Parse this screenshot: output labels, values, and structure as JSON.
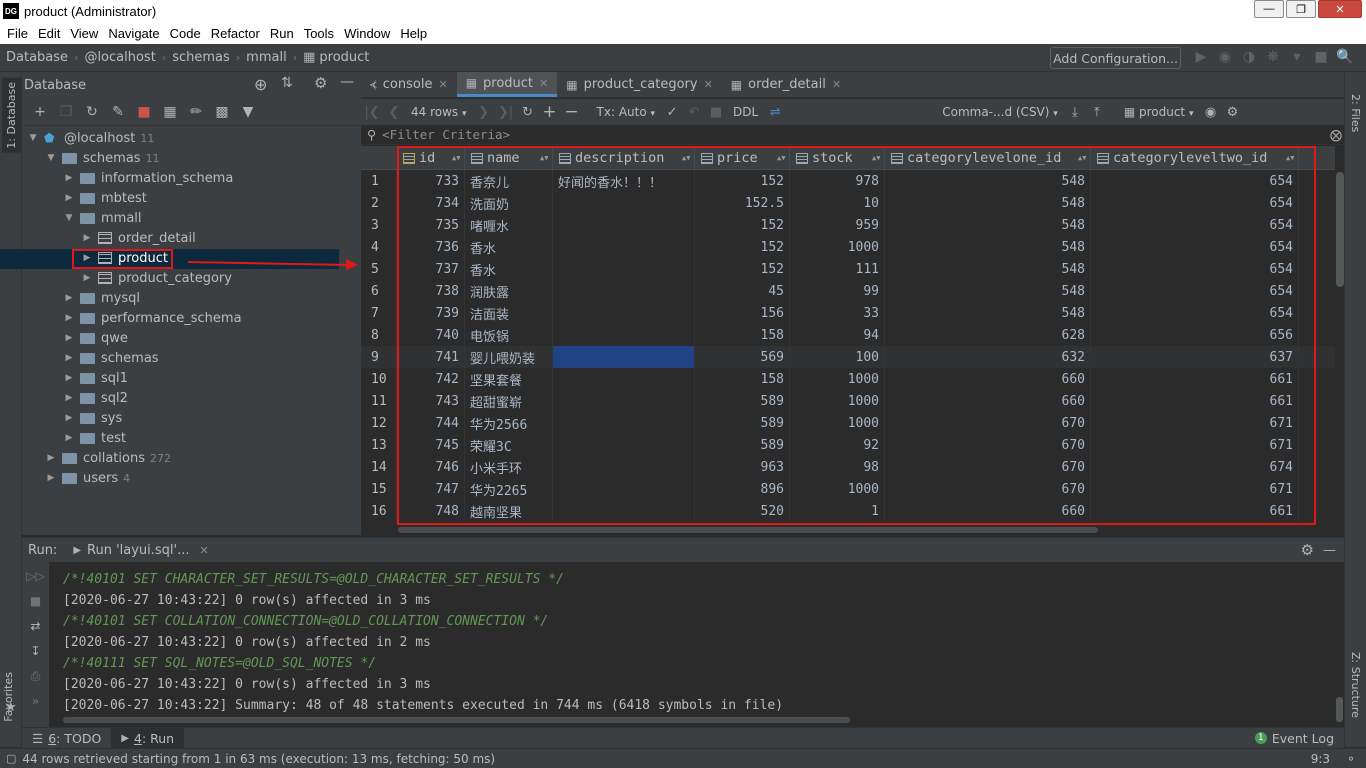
{
  "window": {
    "title": "product (Administrator)",
    "logo": "DG",
    "controls": [
      "minimize-icon",
      "maximize-icon",
      "close-icon"
    ]
  },
  "menu": [
    "File",
    "Edit",
    "View",
    "Navigate",
    "Code",
    "Refactor",
    "Run",
    "Tools",
    "Window",
    "Help"
  ],
  "breadcrumb": [
    "Database",
    "@localhost",
    "schemas",
    "mmall",
    "product"
  ],
  "add_configuration": "Add Configuration...",
  "db_panel": {
    "title": "Database",
    "tree": [
      {
        "label": "@localhost",
        "count": "11",
        "depth": 0,
        "expanded": true,
        "kind": "host"
      },
      {
        "label": "schemas",
        "count": "11",
        "depth": 1,
        "expanded": true,
        "kind": "folder"
      },
      {
        "label": "information_schema",
        "count": "",
        "depth": 2,
        "expanded": false,
        "kind": "folder"
      },
      {
        "label": "mbtest",
        "count": "",
        "depth": 2,
        "expanded": false,
        "kind": "folder"
      },
      {
        "label": "mmall",
        "count": "",
        "depth": 2,
        "expanded": true,
        "kind": "folder"
      },
      {
        "label": "order_detail",
        "count": "",
        "depth": 3,
        "expanded": false,
        "kind": "table"
      },
      {
        "label": "product",
        "count": "",
        "depth": 3,
        "expanded": false,
        "kind": "table",
        "selected": true
      },
      {
        "label": "product_category",
        "count": "",
        "depth": 3,
        "expanded": false,
        "kind": "table"
      },
      {
        "label": "mysql",
        "count": "",
        "depth": 2,
        "expanded": false,
        "kind": "folder"
      },
      {
        "label": "performance_schema",
        "count": "",
        "depth": 2,
        "expanded": false,
        "kind": "folder"
      },
      {
        "label": "qwe",
        "count": "",
        "depth": 2,
        "expanded": false,
        "kind": "folder"
      },
      {
        "label": "schemas",
        "count": "",
        "depth": 2,
        "expanded": false,
        "kind": "folder"
      },
      {
        "label": "sql1",
        "count": "",
        "depth": 2,
        "expanded": false,
        "kind": "folder"
      },
      {
        "label": "sql2",
        "count": "",
        "depth": 2,
        "expanded": false,
        "kind": "folder"
      },
      {
        "label": "sys",
        "count": "",
        "depth": 2,
        "expanded": false,
        "kind": "folder"
      },
      {
        "label": "test",
        "count": "",
        "depth": 2,
        "expanded": false,
        "kind": "folder"
      },
      {
        "label": "collations",
        "count": "272",
        "depth": 1,
        "expanded": false,
        "kind": "folder"
      },
      {
        "label": "users",
        "count": "4",
        "depth": 1,
        "expanded": false,
        "kind": "folder"
      }
    ]
  },
  "editor_tabs": [
    {
      "label": "console",
      "icon": "console-icon",
      "active": false
    },
    {
      "label": "product",
      "icon": "table-icon",
      "active": true
    },
    {
      "label": "product_category",
      "icon": "table-icon",
      "active": false
    },
    {
      "label": "order_detail",
      "icon": "table-icon",
      "active": false
    }
  ],
  "grid_toolbar": {
    "rows": "44 rows",
    "tx": "Tx: Auto",
    "ddl": "DDL",
    "format": "Comma-...d (CSV)",
    "target": "product"
  },
  "filter_placeholder": "<Filter Criteria>",
  "grid": {
    "columns": [
      "id",
      "name",
      "description",
      "price",
      "stock",
      "categorylevelone_id",
      "categoryleveltwo_id"
    ],
    "rows": [
      [
        "1",
        "733",
        "香奈儿",
        "好闻的香水！！！",
        "152",
        "978",
        "548",
        "654"
      ],
      [
        "2",
        "734",
        "洗面奶",
        "",
        "152.5",
        "10",
        "548",
        "654"
      ],
      [
        "3",
        "735",
        "啫喱水",
        "",
        "152",
        "959",
        "548",
        "654"
      ],
      [
        "4",
        "736",
        "香水",
        "",
        "152",
        "1000",
        "548",
        "654"
      ],
      [
        "5",
        "737",
        "香水",
        "",
        "152",
        "111",
        "548",
        "654"
      ],
      [
        "6",
        "738",
        "润肤露",
        "",
        "45",
        "99",
        "548",
        "654"
      ],
      [
        "7",
        "739",
        "洁面装",
        "",
        "156",
        "33",
        "548",
        "654"
      ],
      [
        "8",
        "740",
        "电饭锅",
        "",
        "158",
        "94",
        "628",
        "656"
      ],
      [
        "9",
        "741",
        "婴儿喂奶装",
        "",
        "569",
        "100",
        "632",
        "637"
      ],
      [
        "10",
        "742",
        "坚果套餐",
        "",
        "158",
        "1000",
        "660",
        "661"
      ],
      [
        "11",
        "743",
        "超甜蜜崭",
        "",
        "589",
        "1000",
        "660",
        "661"
      ],
      [
        "12",
        "744",
        "华为2566",
        "",
        "589",
        "1000",
        "670",
        "671"
      ],
      [
        "13",
        "745",
        "荣耀3C",
        "",
        "589",
        "92",
        "670",
        "671"
      ],
      [
        "14",
        "746",
        "小米手环",
        "",
        "963",
        "98",
        "670",
        "674"
      ],
      [
        "15",
        "747",
        "华为2265",
        "",
        "896",
        "1000",
        "670",
        "671"
      ],
      [
        "16",
        "748",
        "越南坚果",
        "",
        "520",
        "1",
        "660",
        "661"
      ]
    ]
  },
  "run_panel": {
    "label": "Run:",
    "tab": "Run 'layui.sql'...",
    "lines": [
      {
        "text": "/*!40101 SET CHARACTER_SET_RESULTS=@OLD_CHARACTER_SET_RESULTS */",
        "comment": true
      },
      {
        "text": "[2020-06-27 10:43:22] 0 row(s) affected in 3 ms",
        "comment": false
      },
      {
        "text": "/*!40101 SET COLLATION_CONNECTION=@OLD_COLLATION_CONNECTION */",
        "comment": true
      },
      {
        "text": "[2020-06-27 10:43:22] 0 row(s) affected in 2 ms",
        "comment": false
      },
      {
        "text": "/*!40111 SET SQL_NOTES=@OLD_SQL_NOTES */",
        "comment": true
      },
      {
        "text": "[2020-06-27 10:43:22] 0 row(s) affected in 3 ms",
        "comment": false
      },
      {
        "text": "[2020-06-27 10:43:22] Summary: 48 of 48 statements executed in 744 ms (6418 symbols in file)",
        "comment": false
      }
    ]
  },
  "bottom_tabs": [
    {
      "num": "6",
      "label": ": TODO"
    },
    {
      "num": "4",
      "label": ": Run"
    }
  ],
  "event_log": "Event Log",
  "status": {
    "message": "44 rows retrieved starting from 1 in 63 ms (execution: 13 ms, fetching: 50 ms)",
    "position": "9:3"
  },
  "side_tabs": {
    "left_top": "1: Database",
    "left_bottom": "Favorites",
    "right_top": "2: Files",
    "right_bottom": "Z: Structure"
  },
  "colors": {
    "accent": "#4a88c7",
    "highlight_box": "#e01818",
    "selection": "#214283"
  }
}
